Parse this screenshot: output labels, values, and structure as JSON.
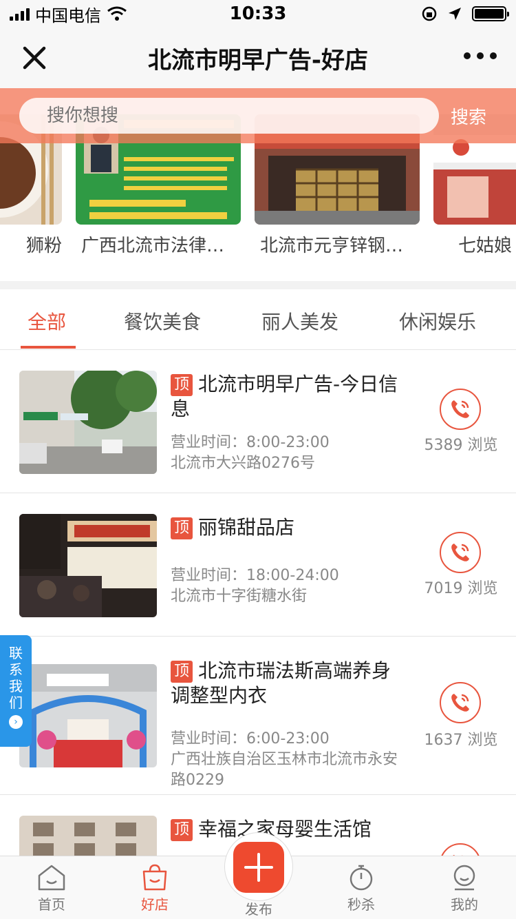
{
  "status_bar": {
    "carrier": "中国电信",
    "time": "10:33"
  },
  "nav": {
    "title": "北流市明早广告-好店"
  },
  "search": {
    "placeholder": "搜你想搜",
    "button": "搜索"
  },
  "carousel": [
    {
      "label": "狮粉"
    },
    {
      "label": "广西北流市法律…"
    },
    {
      "label": "北流市元亨锌钢…"
    },
    {
      "label": "七姑娘"
    }
  ],
  "tabs": [
    {
      "label": "全部",
      "active": true
    },
    {
      "label": "餐饮美食"
    },
    {
      "label": "丽人美发"
    },
    {
      "label": "休闲娱乐"
    }
  ],
  "shops": [
    {
      "badge": "顶",
      "name": "北流市明早广告-今日信息",
      "hours": "营业时间：8:00-23:00",
      "address": "北流市大兴路0276号",
      "views": "5389 浏览"
    },
    {
      "badge": "顶",
      "name": "丽锦甜品店",
      "hours": "营业时间：18:00-24:00",
      "address": "北流市十字街糖水街",
      "views": "7019 浏览"
    },
    {
      "badge": "顶",
      "name": "北流市瑞法斯高端养身调整型内衣",
      "hours": "营业时间：6:00-23:00",
      "address": "广西壮族自治区玉林市北流市永安路0229",
      "views": "1637 浏览"
    },
    {
      "badge": "顶",
      "name": "幸福之家母婴生活馆",
      "hours": "",
      "address": "",
      "views": ""
    }
  ],
  "side_contact": {
    "label": "联系我们"
  },
  "tabbar": {
    "home": "首页",
    "shops": "好店",
    "publish": "发布",
    "flash_sale": "秒杀",
    "mine": "我的"
  },
  "colors": {
    "accent": "#e8553e",
    "side_tab": "#2a96e8"
  }
}
